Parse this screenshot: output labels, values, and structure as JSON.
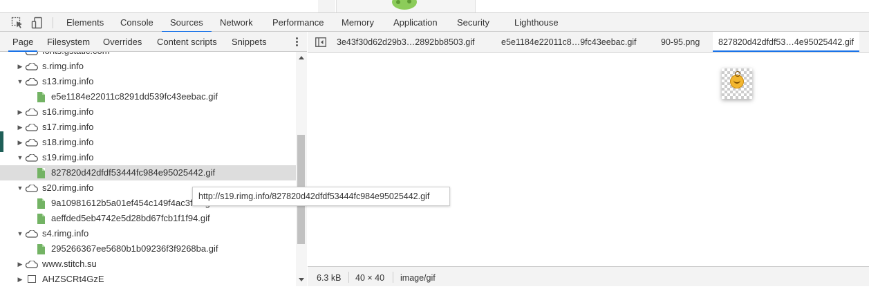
{
  "toolbar": {
    "icons": [
      "inspect-element-icon",
      "device-toolbar-icon"
    ],
    "tabs": [
      "Elements",
      "Console",
      "Sources",
      "Network",
      "Performance",
      "Memory",
      "Application",
      "Security",
      "Lighthouse"
    ],
    "active_tab": "Sources"
  },
  "navigator": {
    "tabs": [
      "Page",
      "Filesystem",
      "Overrides",
      "Content scripts",
      "Snippets"
    ],
    "active_tab": "Page",
    "tree": [
      {
        "label": "fonts.gstatic.com",
        "kind": "domain",
        "partial": true
      },
      {
        "label": "s.rimg.info",
        "kind": "domain",
        "expanded": false
      },
      {
        "label": "s13.rimg.info",
        "kind": "domain",
        "expanded": true
      },
      {
        "label": "e5e1184e22011c8291dd539fc43eebac.gif",
        "kind": "file"
      },
      {
        "label": "s16.rimg.info",
        "kind": "domain",
        "expanded": false
      },
      {
        "label": "s17.rimg.info",
        "kind": "domain",
        "expanded": false
      },
      {
        "label": "s18.rimg.info",
        "kind": "domain",
        "expanded": false
      },
      {
        "label": "s19.rimg.info",
        "kind": "domain",
        "expanded": true
      },
      {
        "label": "827820d42dfdf53444fc984e95025442.gif",
        "kind": "file",
        "selected": true
      },
      {
        "label": "s20.rimg.info",
        "kind": "domain",
        "expanded": true
      },
      {
        "label": "9a10981612b5a01ef454c149f4ac3f09.gif",
        "kind": "file"
      },
      {
        "label": "aeffded5eb4742e5d28bd67fcb1f1f94.gif",
        "kind": "file"
      },
      {
        "label": "s4.rimg.info",
        "kind": "domain",
        "expanded": true
      },
      {
        "label": "295266367ee5680b1b09236f3f9268ba.gif",
        "kind": "file"
      },
      {
        "label": "www.stitch.su",
        "kind": "domain",
        "expanded": false
      },
      {
        "label": "AHZSCRt4GzE",
        "kind": "frame",
        "expanded": false
      }
    ]
  },
  "editor": {
    "tabs": [
      "3e43f30d62d29b3…2892bb8503.gif",
      "e5e1184e22011c8…9fc43eebac.gif",
      "90-95.png",
      "827820d42dfdf53…4e95025442.gif"
    ],
    "active_tab_index": 3
  },
  "tooltip": {
    "text": "http://s19.rimg.info/827820d42dfdf53444fc984e95025442.gif"
  },
  "footer": {
    "size": "6.3 kB",
    "dimensions": "40 × 40",
    "mime": "image/gif"
  },
  "colors": {
    "accent": "#1a73e8",
    "file_icon": "#73b364",
    "selected_row": "#dddddd"
  }
}
